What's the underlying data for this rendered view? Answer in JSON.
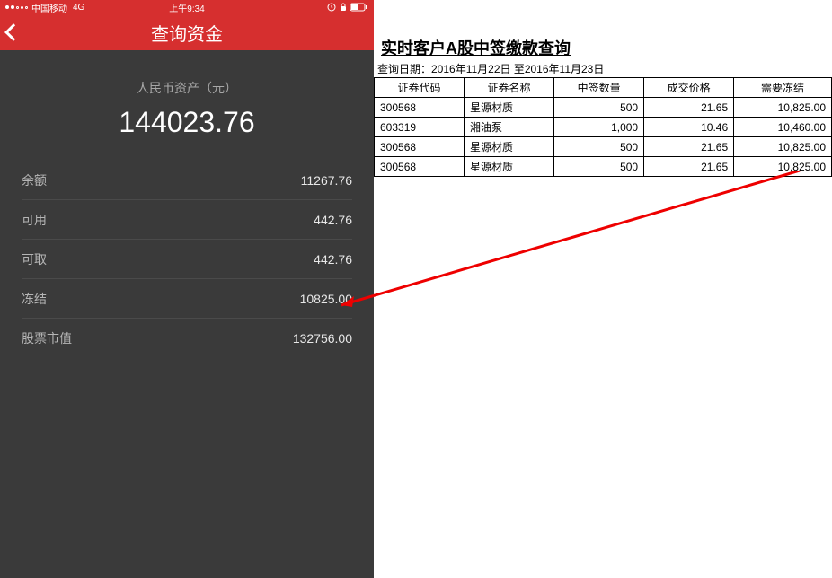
{
  "status": {
    "carrier": "中国移动",
    "network": "4G",
    "time": "上午9:34"
  },
  "nav": {
    "title": "查询资金"
  },
  "summary": {
    "label": "人民币资产（元）",
    "value": "144023.76"
  },
  "rows": [
    {
      "label": "余额",
      "value": "11267.76"
    },
    {
      "label": "可用",
      "value": "442.76"
    },
    {
      "label": "可取",
      "value": "442.76"
    },
    {
      "label": "冻结",
      "value": "10825.00"
    },
    {
      "label": "股票市值",
      "value": "132756.00"
    }
  ],
  "report": {
    "title": "实时客户A股中签缴款查询",
    "date_label": "查询日期：2016年11月22日 至2016年11月23日",
    "headers": [
      "证券代码",
      "证券名称",
      "中签数量",
      "成交价格",
      "需要冻结"
    ],
    "rows": [
      {
        "code": "300568",
        "name": "星源材质",
        "qty": "500",
        "price": "21.65",
        "freeze": "10,825.00"
      },
      {
        "code": "603319",
        "name": "湘油泵",
        "qty": "1,000",
        "price": "10.46",
        "freeze": "10,460.00"
      },
      {
        "code": "300568",
        "name": "星源材质",
        "qty": "500",
        "price": "21.65",
        "freeze": "10,825.00"
      },
      {
        "code": "300568",
        "name": "星源材质",
        "qty": "500",
        "price": "21.65",
        "freeze": "10,825.00"
      }
    ]
  }
}
